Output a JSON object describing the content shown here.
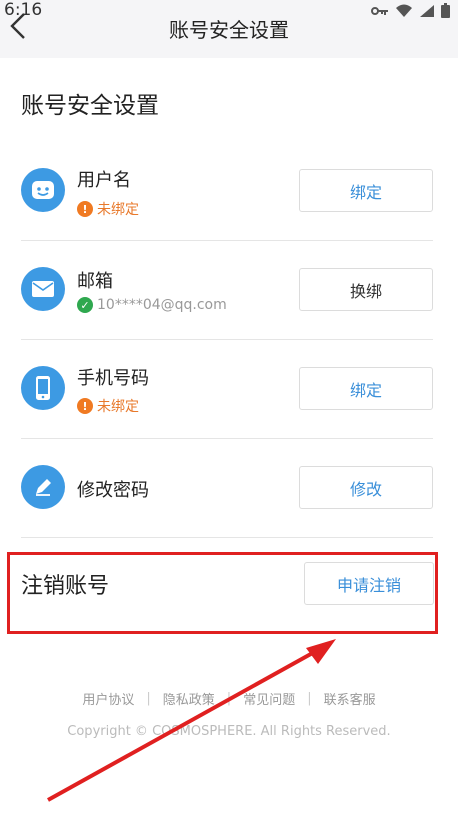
{
  "status_bar": {
    "time": "6:16"
  },
  "header": {
    "title": "账号安全设置"
  },
  "section": {
    "title": "账号安全设置"
  },
  "rows": [
    {
      "label": "用户名",
      "status": "未绑定",
      "button": "绑定",
      "icon": "face-icon"
    },
    {
      "label": "邮箱",
      "status": "10****04@qq.com",
      "button": "换绑",
      "icon": "mail-icon"
    },
    {
      "label": "手机号码",
      "status": "未绑定",
      "button": "绑定",
      "icon": "phone-icon"
    },
    {
      "label": "修改密码",
      "button": "修改",
      "icon": "pencil-icon"
    }
  ],
  "cancel_account": {
    "title": "注销账号",
    "button": "申请注销"
  },
  "footer": {
    "links": [
      "用户协议",
      "隐私政策",
      "常见问题",
      "联系客服"
    ],
    "copyright": "Copyright © COSMOSPHERE. All Rights Reserved."
  },
  "colors": {
    "accent": "#3a8fd9",
    "warning": "#f07a22",
    "success": "#2fa84f",
    "highlight": "#e02020"
  }
}
